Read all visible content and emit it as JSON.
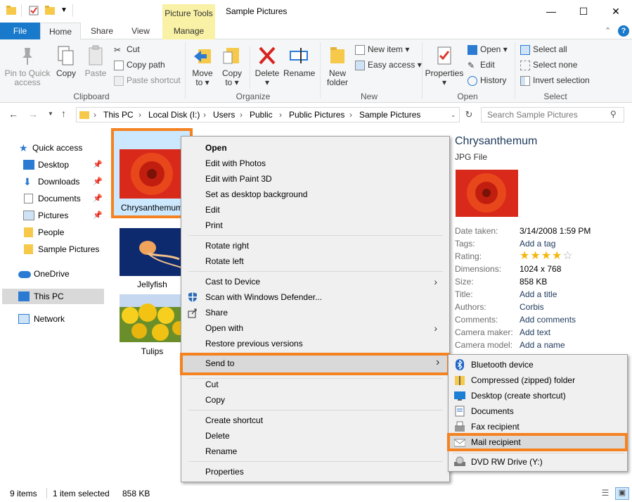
{
  "window": {
    "title": "Sample Pictures",
    "context_tab_title": "Picture Tools"
  },
  "tabs": {
    "file": "File",
    "home": "Home",
    "share": "Share",
    "view": "View",
    "manage": "Manage"
  },
  "ribbon": {
    "clipboard": {
      "pin": "Pin to Quick access",
      "pin_l1": "Pin to Quick",
      "pin_l2": "access",
      "copy": "Copy",
      "paste": "Paste",
      "cut": "Cut",
      "copy_path": "Copy path",
      "paste_shortcut": "Paste shortcut",
      "label": "Clipboard"
    },
    "organize": {
      "move_l1": "Move",
      "move_l2": "to ▾",
      "copy_l1": "Copy",
      "copy_l2": "to ▾",
      "delete_l1": "Delete",
      "delete_l2": "▾",
      "rename": "Rename",
      "label": "Organize"
    },
    "new": {
      "folder_l1": "New",
      "folder_l2": "folder",
      "new_item": "New item ▾",
      "easy_access": "Easy access ▾",
      "label": "New"
    },
    "open": {
      "properties_l1": "Properties",
      "properties_l2": "▾",
      "open": "Open ▾",
      "edit": "Edit",
      "history": "History",
      "label": "Open"
    },
    "select": {
      "select_all": "Select all",
      "select_none": "Select none",
      "invert": "Invert selection",
      "label": "Select"
    }
  },
  "address": {
    "crumbs": [
      "This PC",
      "Local Disk (I:)",
      "Users",
      "Public",
      "Public Pictures",
      "Sample Pictures"
    ],
    "search_placeholder": "Search Sample Pictures"
  },
  "nav": {
    "quick_access": "Quick access",
    "desktop": "Desktop",
    "downloads": "Downloads",
    "documents": "Documents",
    "pictures": "Pictures",
    "people": "People",
    "sample_pictures": "Sample Pictures",
    "onedrive": "OneDrive",
    "this_pc": "This PC",
    "network": "Network"
  },
  "files": {
    "chrysanthemum": "Chrysanthemum",
    "jellyfish": "Jellyfish",
    "tulips": "Tulips"
  },
  "context_menu": {
    "open": "Open",
    "edit_photos": "Edit with Photos",
    "edit_paint3d": "Edit with Paint 3D",
    "set_bg": "Set as desktop background",
    "edit": "Edit",
    "print": "Print",
    "rotate_right": "Rotate right",
    "rotate_left": "Rotate left",
    "cast": "Cast to Device",
    "scan": "Scan with Windows Defender...",
    "share": "Share",
    "open_with": "Open with",
    "restore": "Restore previous versions",
    "send_to": "Send to",
    "cut": "Cut",
    "copy": "Copy",
    "create_shortcut": "Create shortcut",
    "delete": "Delete",
    "rename": "Rename",
    "properties": "Properties"
  },
  "send_to": {
    "bluetooth": "Bluetooth device",
    "zip": "Compressed (zipped) folder",
    "desktop": "Desktop (create shortcut)",
    "documents": "Documents",
    "fax": "Fax recipient",
    "mail": "Mail recipient",
    "dvd": "DVD RW Drive (Y:)"
  },
  "details": {
    "name": "Chrysanthemum",
    "type": "JPG File",
    "rows": [
      {
        "label": "Date taken:",
        "value": "3/14/2008 1:59 PM"
      },
      {
        "label": "Tags:",
        "value": "Add a tag"
      },
      {
        "label": "Rating:",
        "value": ""
      },
      {
        "label": "Dimensions:",
        "value": "1024 x 768"
      },
      {
        "label": "Size:",
        "value": "858 KB"
      },
      {
        "label": "Title:",
        "value": "Add a title"
      },
      {
        "label": "Authors:",
        "value": "Corbis"
      },
      {
        "label": "Comments:",
        "value": "Add comments"
      },
      {
        "label": "Camera maker:",
        "value": "Add text"
      },
      {
        "label": "Camera model:",
        "value": "Add a name"
      }
    ],
    "rating_stars": 4
  },
  "status": {
    "items": "9 items",
    "selected": "1 item selected",
    "size": "858 KB"
  },
  "colors": {
    "accent": "#1979ca",
    "highlight": "#f58220",
    "selection": "#cce8ff"
  }
}
